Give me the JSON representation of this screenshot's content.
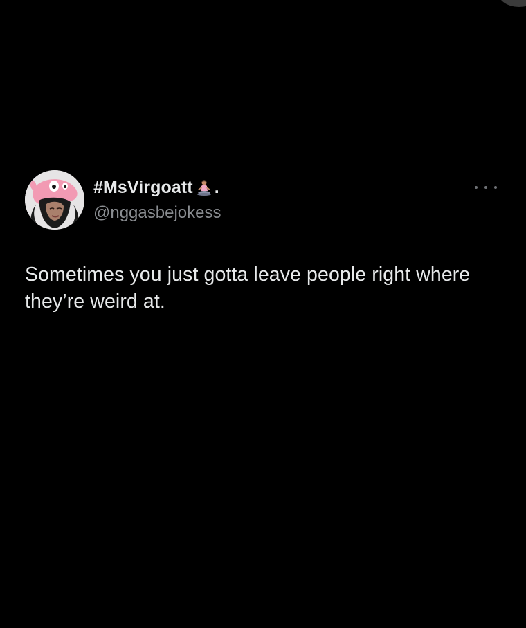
{
  "tweet": {
    "author": {
      "display_name": "#MsVirgoatt",
      "name_emoji": "person-in-lotus-position-icon",
      "name_suffix": ".",
      "handle": "@nggasbejokess"
    },
    "text": "Sometimes you just gotta leave people right where they’re weird at.",
    "more_icon": "more-options-icon"
  },
  "colors": {
    "background": "#000000",
    "primary_text": "#e7e9ea",
    "secondary_text": "#8a8d91",
    "icon_gray": "#6e7175"
  }
}
